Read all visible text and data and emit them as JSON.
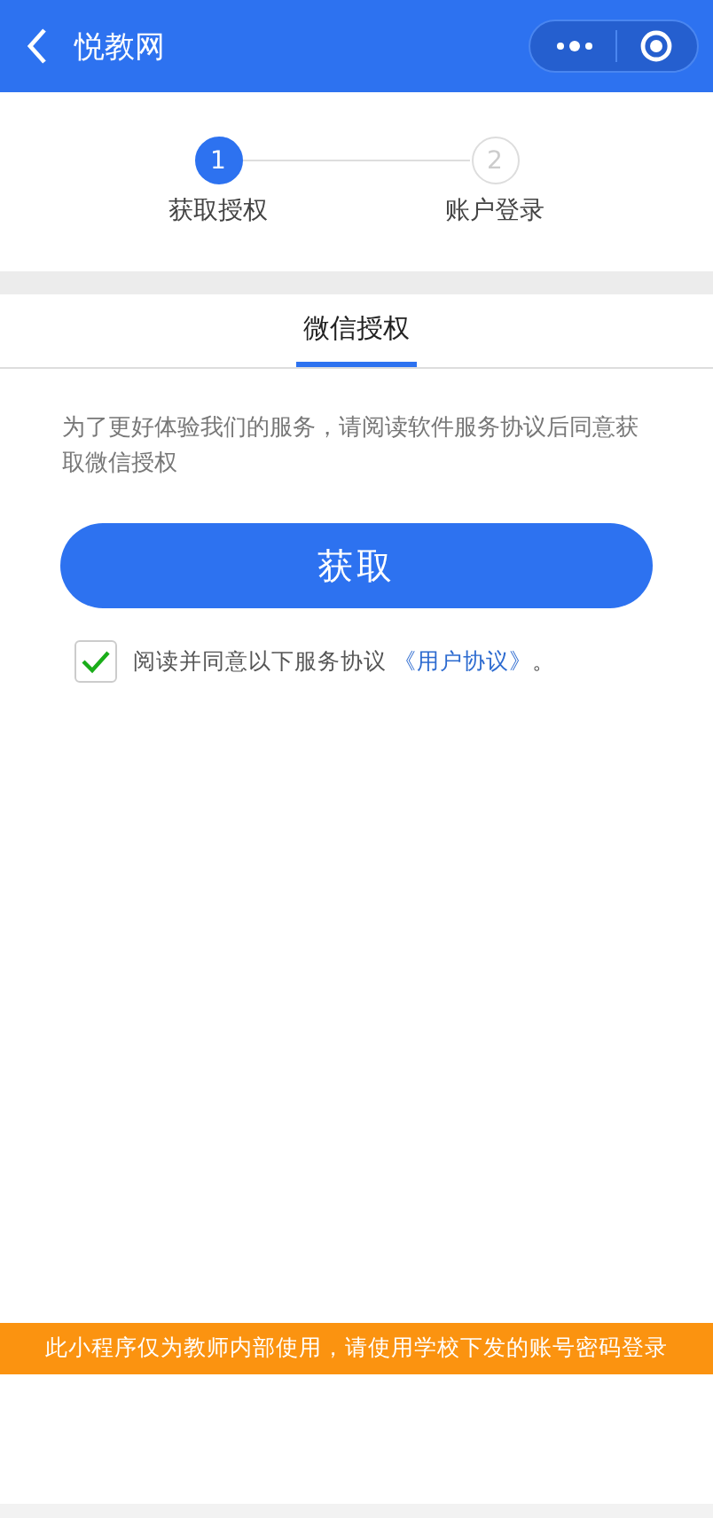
{
  "nav_bar": {
    "title": "悦教网"
  },
  "steps": [
    {
      "number": "1",
      "label": "获取授权",
      "selected": true
    },
    {
      "number": "2",
      "label": "账户登录",
      "selected": false
    }
  ],
  "tabs": [
    {
      "label": "微信授权",
      "selected": true
    }
  ],
  "intro": "为了更好体验我们的服务，请阅读软件服务协议后同意获取微信授权",
  "action_button": "获取",
  "agreement": {
    "checked": true,
    "text": "阅读并同意以下服务协议",
    "link": "《用户协议》",
    "suffix": "。"
  },
  "notice_bar": "此小程序仅为教师内部使用，请使用学校下发的账号密码登录"
}
